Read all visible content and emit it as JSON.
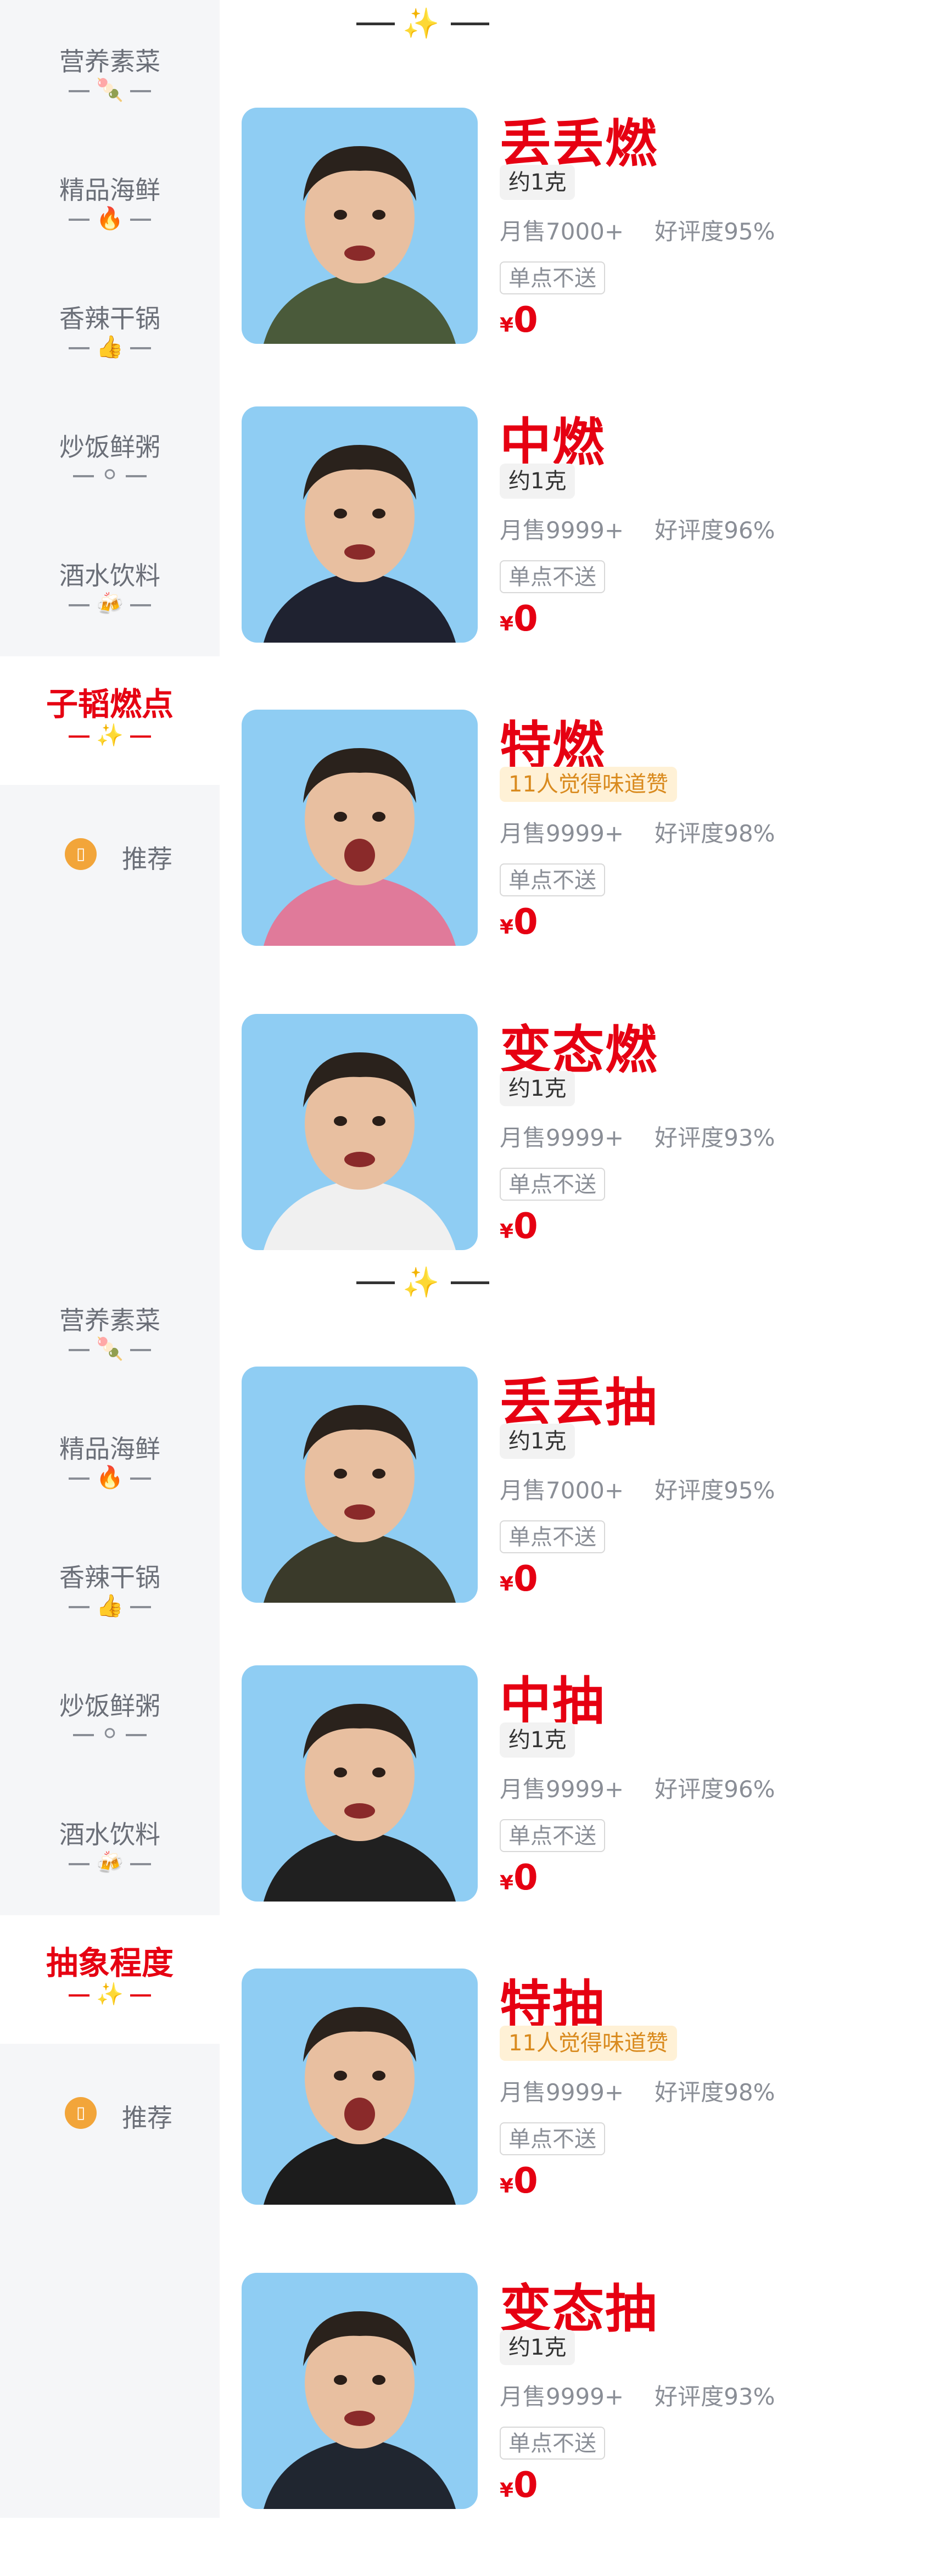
{
  "sections": [
    {
      "divider": "✨",
      "categories": [
        {
          "label": "营养素菜",
          "icon": "🍡"
        },
        {
          "label": "精品海鲜",
          "icon": "🔥"
        },
        {
          "label": "香辣干锅",
          "icon": "👍"
        },
        {
          "label": "炒饭鲜粥",
          "icon": "⚪"
        },
        {
          "label": "酒水饮料",
          "icon": "🍻"
        },
        {
          "label": "子韬燃点",
          "icon": "✨",
          "active": true
        }
      ],
      "recommend_label": "推荐",
      "items": [
        {
          "title": "丢丢燃",
          "tag": "约1克",
          "sales": "月售7000+",
          "rating": "好评度95%",
          "no_send": "单点不送",
          "currency": "¥",
          "price": "0"
        },
        {
          "title": "中燃",
          "tag": "约1克",
          "sales": "月售9999+",
          "rating": "好评度96%",
          "no_send": "单点不送",
          "currency": "¥",
          "price": "0"
        },
        {
          "title": "特燃",
          "tag": "11人觉得味道赞",
          "tag_style": "praise",
          "sales": "月售9999+",
          "rating": "好评度98%",
          "no_send": "单点不送",
          "currency": "¥",
          "price": "0"
        },
        {
          "title": "变态燃",
          "tag": "约1克",
          "sales": "月售9999+",
          "rating": "好评度93%",
          "no_send": "单点不送",
          "currency": "¥",
          "price": "0"
        }
      ]
    },
    {
      "divider": "✨",
      "categories": [
        {
          "label": "营养素菜",
          "icon": "🍡"
        },
        {
          "label": "精品海鲜",
          "icon": "🔥"
        },
        {
          "label": "香辣干锅",
          "icon": "👍"
        },
        {
          "label": "炒饭鲜粥",
          "icon": "⚪"
        },
        {
          "label": "酒水饮料",
          "icon": "🍻"
        },
        {
          "label": "抽象程度",
          "icon": "✨",
          "active": true
        }
      ],
      "recommend_label": "推荐",
      "items": [
        {
          "title": "丢丢抽",
          "tag": "约1克",
          "sales": "月售7000+",
          "rating": "好评度95%",
          "no_send": "单点不送",
          "currency": "¥",
          "price": "0"
        },
        {
          "title": "中抽",
          "tag": "约1克",
          "sales": "月售9999+",
          "rating": "好评度96%",
          "no_send": "单点不送",
          "currency": "¥",
          "price": "0"
        },
        {
          "title": "特抽",
          "tag": "11人觉得味道赞",
          "tag_style": "praise",
          "sales": "月售9999+",
          "rating": "好评度98%",
          "no_send": "单点不送",
          "currency": "¥",
          "price": "0"
        },
        {
          "title": "变态抽",
          "tag": "约1克",
          "sales": "月售9999+",
          "rating": "好评度93%",
          "no_send": "单点不送",
          "currency": "¥",
          "price": "0"
        }
      ]
    }
  ],
  "colors": {
    "accent": "#e60012",
    "sidebar_bg": "#f5f6f8",
    "thumb_bg": "#8fcdf3",
    "praise_bg": "#fff1d6",
    "praise_text": "#d98a1e"
  }
}
